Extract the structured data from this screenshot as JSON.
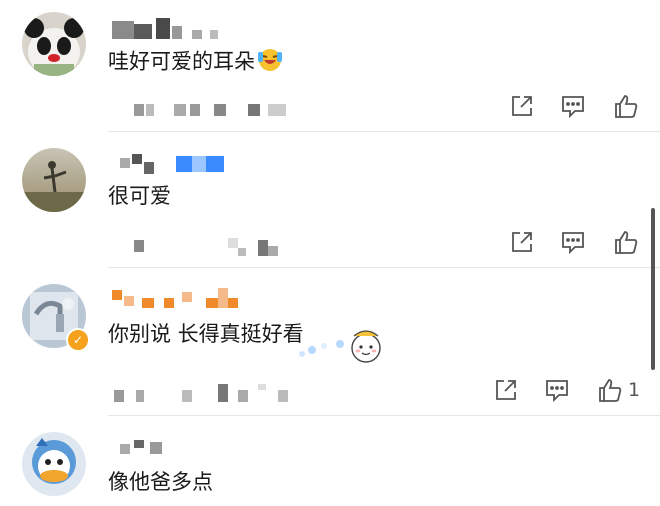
{
  "comments": [
    {
      "text": "哇好可爱的耳朵",
      "avatar_icon": "panda-avatar-icon",
      "emoji": "laughing-crying-emoji-icon",
      "like_count": ""
    },
    {
      "text": "很可爱",
      "avatar_icon": "landscape-figure-avatar-icon",
      "like_count": ""
    },
    {
      "text": "你别说 长得真挺好看",
      "avatar_icon": "faucet-photo-avatar-icon",
      "verified_badge": "✓",
      "sticker": "cute-character-sticker-icon",
      "like_count": "1"
    },
    {
      "text": "像他爸多点",
      "avatar_icon": "duck-cartoon-avatar-icon",
      "like_count": ""
    }
  ],
  "action_icons": [
    "share-icon",
    "reply-icon",
    "like-icon"
  ],
  "colors": {
    "username_blue": "#3b8bff",
    "username_orange": "#f08a2a",
    "badge": "#f6a21d"
  }
}
